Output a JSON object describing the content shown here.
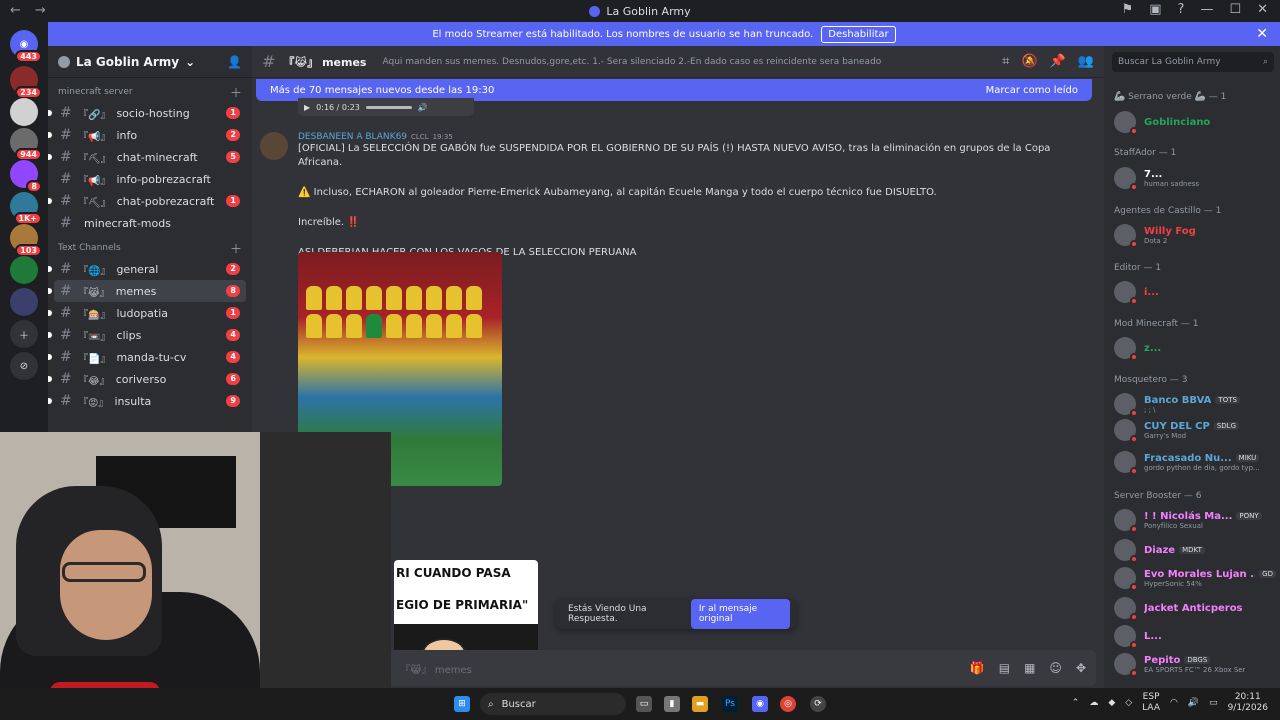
{
  "window": {
    "title": "La Goblin Army"
  },
  "banner": {
    "text": "El modo Streamer está habilitado. Los nombres de usuario se han truncado.",
    "button": "Deshabilitar"
  },
  "servers": [
    {
      "badge": "443"
    },
    {
      "badge": "234"
    },
    {
      "badge": ""
    },
    {
      "badge": "944"
    },
    {
      "badge": "8"
    },
    {
      "badge": "1K+"
    },
    {
      "badge": "103"
    },
    {
      "badge": ""
    },
    {
      "badge": ""
    }
  ],
  "guild": {
    "name": "La Goblin Army"
  },
  "categories": {
    "mc": "minecraft server",
    "text": "Text Channels"
  },
  "channels_mc": [
    {
      "emoji": "『🔗』",
      "name": "socio-hosting",
      "count": "1"
    },
    {
      "emoji": "『📢』",
      "name": "info",
      "count": "2"
    },
    {
      "emoji": "『⛏』",
      "name": "chat-minecraft",
      "count": "5"
    },
    {
      "emoji": "『📢』",
      "name": "info-pobrezacraft",
      "count": ""
    },
    {
      "emoji": "『⛏』",
      "name": "chat-pobrezacraft",
      "count": "1"
    },
    {
      "emoji": "",
      "name": "minecraft-mods",
      "count": ""
    }
  ],
  "channels_text": [
    {
      "emoji": "『🌐』",
      "name": "general",
      "count": "2"
    },
    {
      "emoji": "『😹』",
      "name": "memes",
      "count": "8"
    },
    {
      "emoji": "『🎰』",
      "name": "ludopatia",
      "count": "1"
    },
    {
      "emoji": "『📼』",
      "name": "clips",
      "count": "4"
    },
    {
      "emoji": "『📄』",
      "name": "manda-tu-cv",
      "count": "4"
    },
    {
      "emoji": "『😂』",
      "name": "coriverso",
      "count": "6"
    },
    {
      "emoji": "『😡』",
      "name": "insulta",
      "count": "9"
    }
  ],
  "chat": {
    "channel": "『😹』 memes",
    "topic": "Aqui manden sus memes. Desnudos,gore,etc. 1.- Sera silenciado 2.-En dado caso es reincidente sera baneado",
    "newbar": "Más de 70 mensajes nuevos desde las 19:30",
    "markread": "Marcar como leído",
    "audio_time": "0:16 / 0:23",
    "author": "DESBANEEN A BLANK69",
    "clan": "CLCL",
    "time": "19:35",
    "lines": [
      "[OFICIAL] La SELECCIÓN DE GABÓN fue SUSPENDIDA POR EL GOBIERNO DE SU PAÍS (!) HASTA NUEVO AVISO, tras la eliminación en grupos de la Copa Africana.",
      "⚠️ Incluso, ECHARON al goleador Pierre-Emerick Aubameyang, al capitán Ecuele Manga y todo el cuerpo técnico fue DISUELTO.",
      "Increíble. ‼️",
      "ASI DEBERIAN HACER CON LOS VAGOS DE LA SELECCION PERUANA"
    ],
    "meme_line1": "RI CUANDO PASA",
    "meme_line2": "EGIO DE PRIMARIA\"",
    "reply_text": "Estás Viendo Una Respuesta.",
    "reply_button": "Ir al mensaje original",
    "composer": "『😹』 memes"
  },
  "members": {
    "search": "Buscar La Goblin Army",
    "roles": [
      "🦾 Serrano verde 🦾 — 1",
      "StaffAdor — 1",
      "Agentes de Castillo — 1",
      "Editor — 1",
      "Mod Minecraft — 1",
      "Mosquetero — 3",
      "Server Booster — 6"
    ],
    "list": [
      {
        "name": "Goblinciano",
        "sub": "",
        "tag": "",
        "color": "#23a55a"
      },
      {
        "name": "7...",
        "sub": "human sadness",
        "tag": "",
        "color": "#ffffff"
      },
      {
        "name": "Willy Fog",
        "sub": "Dota 2",
        "tag": "",
        "color": "#f23f43"
      },
      {
        "name": "i...",
        "sub": "",
        "tag": "",
        "color": "#f23f43"
      },
      {
        "name": "z...",
        "sub": "",
        "tag": "",
        "color": "#23a55a"
      },
      {
        "name": "Banco BBVA",
        "sub": "; ; \\",
        "tag": "TOTS",
        "color": "#5ba7d8"
      },
      {
        "name": "CUY DEL CP",
        "sub": "Garry's Mod",
        "tag": "SDLG",
        "color": "#5ba7d8"
      },
      {
        "name": "Fracasado Nu...",
        "sub": "gordo python de dia, gordo typ...",
        "tag": "MIKU",
        "color": "#5ba7d8"
      },
      {
        "name": "! ! Nicolás Ma...",
        "sub": "Ponyfílico Sexual",
        "tag": "PONY",
        "color": "#f47fff"
      },
      {
        "name": "Diaze",
        "sub": "",
        "tag": "MDKT",
        "color": "#f47fff"
      },
      {
        "name": "Evo Morales Lujan ...",
        "sub": "HyperSonic 54%",
        "tag": "GD",
        "color": "#f47fff"
      },
      {
        "name": "Jacket Anticperos",
        "sub": "",
        "tag": "",
        "color": "#f47fff"
      },
      {
        "name": "L...",
        "sub": "",
        "tag": "",
        "color": "#f47fff"
      },
      {
        "name": "Pepito",
        "sub": "EA SPORTS FC™ 26 Xbox Ser",
        "tag": "DBGS",
        "color": "#f47fff"
      }
    ]
  },
  "taskbar": {
    "search": "Buscar",
    "lang1": "ESP",
    "lang2": "LAA",
    "time": "20:11",
    "date": "9/1/2026"
  }
}
